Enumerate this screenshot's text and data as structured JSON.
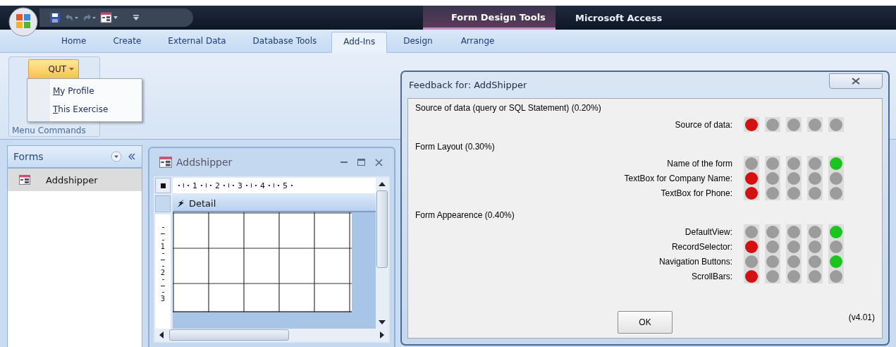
{
  "app": {
    "title": "Microsoft Access",
    "contextual_group": "Form Design Tools"
  },
  "ribbon_tabs": [
    {
      "label": "Home",
      "selected": false
    },
    {
      "label": "Create",
      "selected": false
    },
    {
      "label": "External Data",
      "selected": false
    },
    {
      "label": "Database Tools",
      "selected": false
    },
    {
      "label": "Add-Ins",
      "selected": true
    },
    {
      "label": "Design",
      "selected": false
    },
    {
      "label": "Arrange",
      "selected": false
    }
  ],
  "ribbon": {
    "button": "QUT",
    "group_label": "Menu Commands",
    "menu": [
      {
        "label": "My Profile"
      },
      {
        "label": "This Exercise"
      }
    ]
  },
  "nav_pane": {
    "title": "Forms",
    "items": [
      {
        "label": "Addshipper",
        "selected": true
      }
    ]
  },
  "form_window": {
    "title": "Addshipper",
    "ruler_h": [
      "1",
      "2",
      "3",
      "4",
      "5"
    ],
    "ruler_v": [
      "1",
      "2",
      "3"
    ],
    "section": "Detail"
  },
  "feedback": {
    "title": "Feedback for: AddShipper",
    "sections": [
      {
        "heading": "Source of data (query or SQL Statement) (0.20%)",
        "criteria": [
          {
            "label": "Source of data:",
            "lights": [
              {
                "color": "#d41010"
              },
              {
                "color": "#9c9c9c"
              },
              {
                "color": "#9c9c9c"
              },
              {
                "color": "#9c9c9c"
              },
              {
                "color": "#9c9c9c"
              }
            ]
          }
        ]
      },
      {
        "heading": "Form Layout (0.30%)",
        "criteria": [
          {
            "label": "Name of the form",
            "lights": [
              {
                "color": "#9c9c9c"
              },
              {
                "color": "#9c9c9c"
              },
              {
                "color": "#9c9c9c"
              },
              {
                "color": "#9c9c9c"
              },
              {
                "color": "#1ec41e"
              }
            ]
          },
          {
            "label": "TextBox for Company Name:",
            "lights": [
              {
                "color": "#d41010"
              },
              {
                "color": "#9c9c9c"
              },
              {
                "color": "#9c9c9c"
              },
              {
                "color": "#9c9c9c"
              },
              {
                "color": "#9c9c9c"
              }
            ]
          },
          {
            "label": "TextBox for Phone:",
            "lights": [
              {
                "color": "#d41010"
              },
              {
                "color": "#9c9c9c"
              },
              {
                "color": "#9c9c9c"
              },
              {
                "color": "#9c9c9c"
              },
              {
                "color": "#9c9c9c"
              }
            ]
          }
        ]
      },
      {
        "heading": "Form Appearence (0.40%)",
        "criteria": [
          {
            "label": "DefaultView:",
            "lights": [
              {
                "color": "#9c9c9c"
              },
              {
                "color": "#9c9c9c"
              },
              {
                "color": "#9c9c9c"
              },
              {
                "color": "#9c9c9c"
              },
              {
                "color": "#1ec41e"
              }
            ]
          },
          {
            "label": "RecordSelector:",
            "lights": [
              {
                "color": "#d41010"
              },
              {
                "color": "#9c9c9c"
              },
              {
                "color": "#9c9c9c"
              },
              {
                "color": "#9c9c9c"
              },
              {
                "color": "#9c9c9c"
              }
            ]
          },
          {
            "label": "Navigation Buttons:",
            "lights": [
              {
                "color": "#9c9c9c"
              },
              {
                "color": "#9c9c9c"
              },
              {
                "color": "#9c9c9c"
              },
              {
                "color": "#9c9c9c"
              },
              {
                "color": "#1ec41e"
              }
            ]
          },
          {
            "label": "ScrollBars:",
            "lights": [
              {
                "color": "#d41010"
              },
              {
                "color": "#9c9c9c"
              },
              {
                "color": "#9c9c9c"
              },
              {
                "color": "#9c9c9c"
              },
              {
                "color": "#9c9c9c"
              }
            ]
          }
        ]
      }
    ],
    "ok_button": "OK",
    "version": "(v4.01)"
  }
}
